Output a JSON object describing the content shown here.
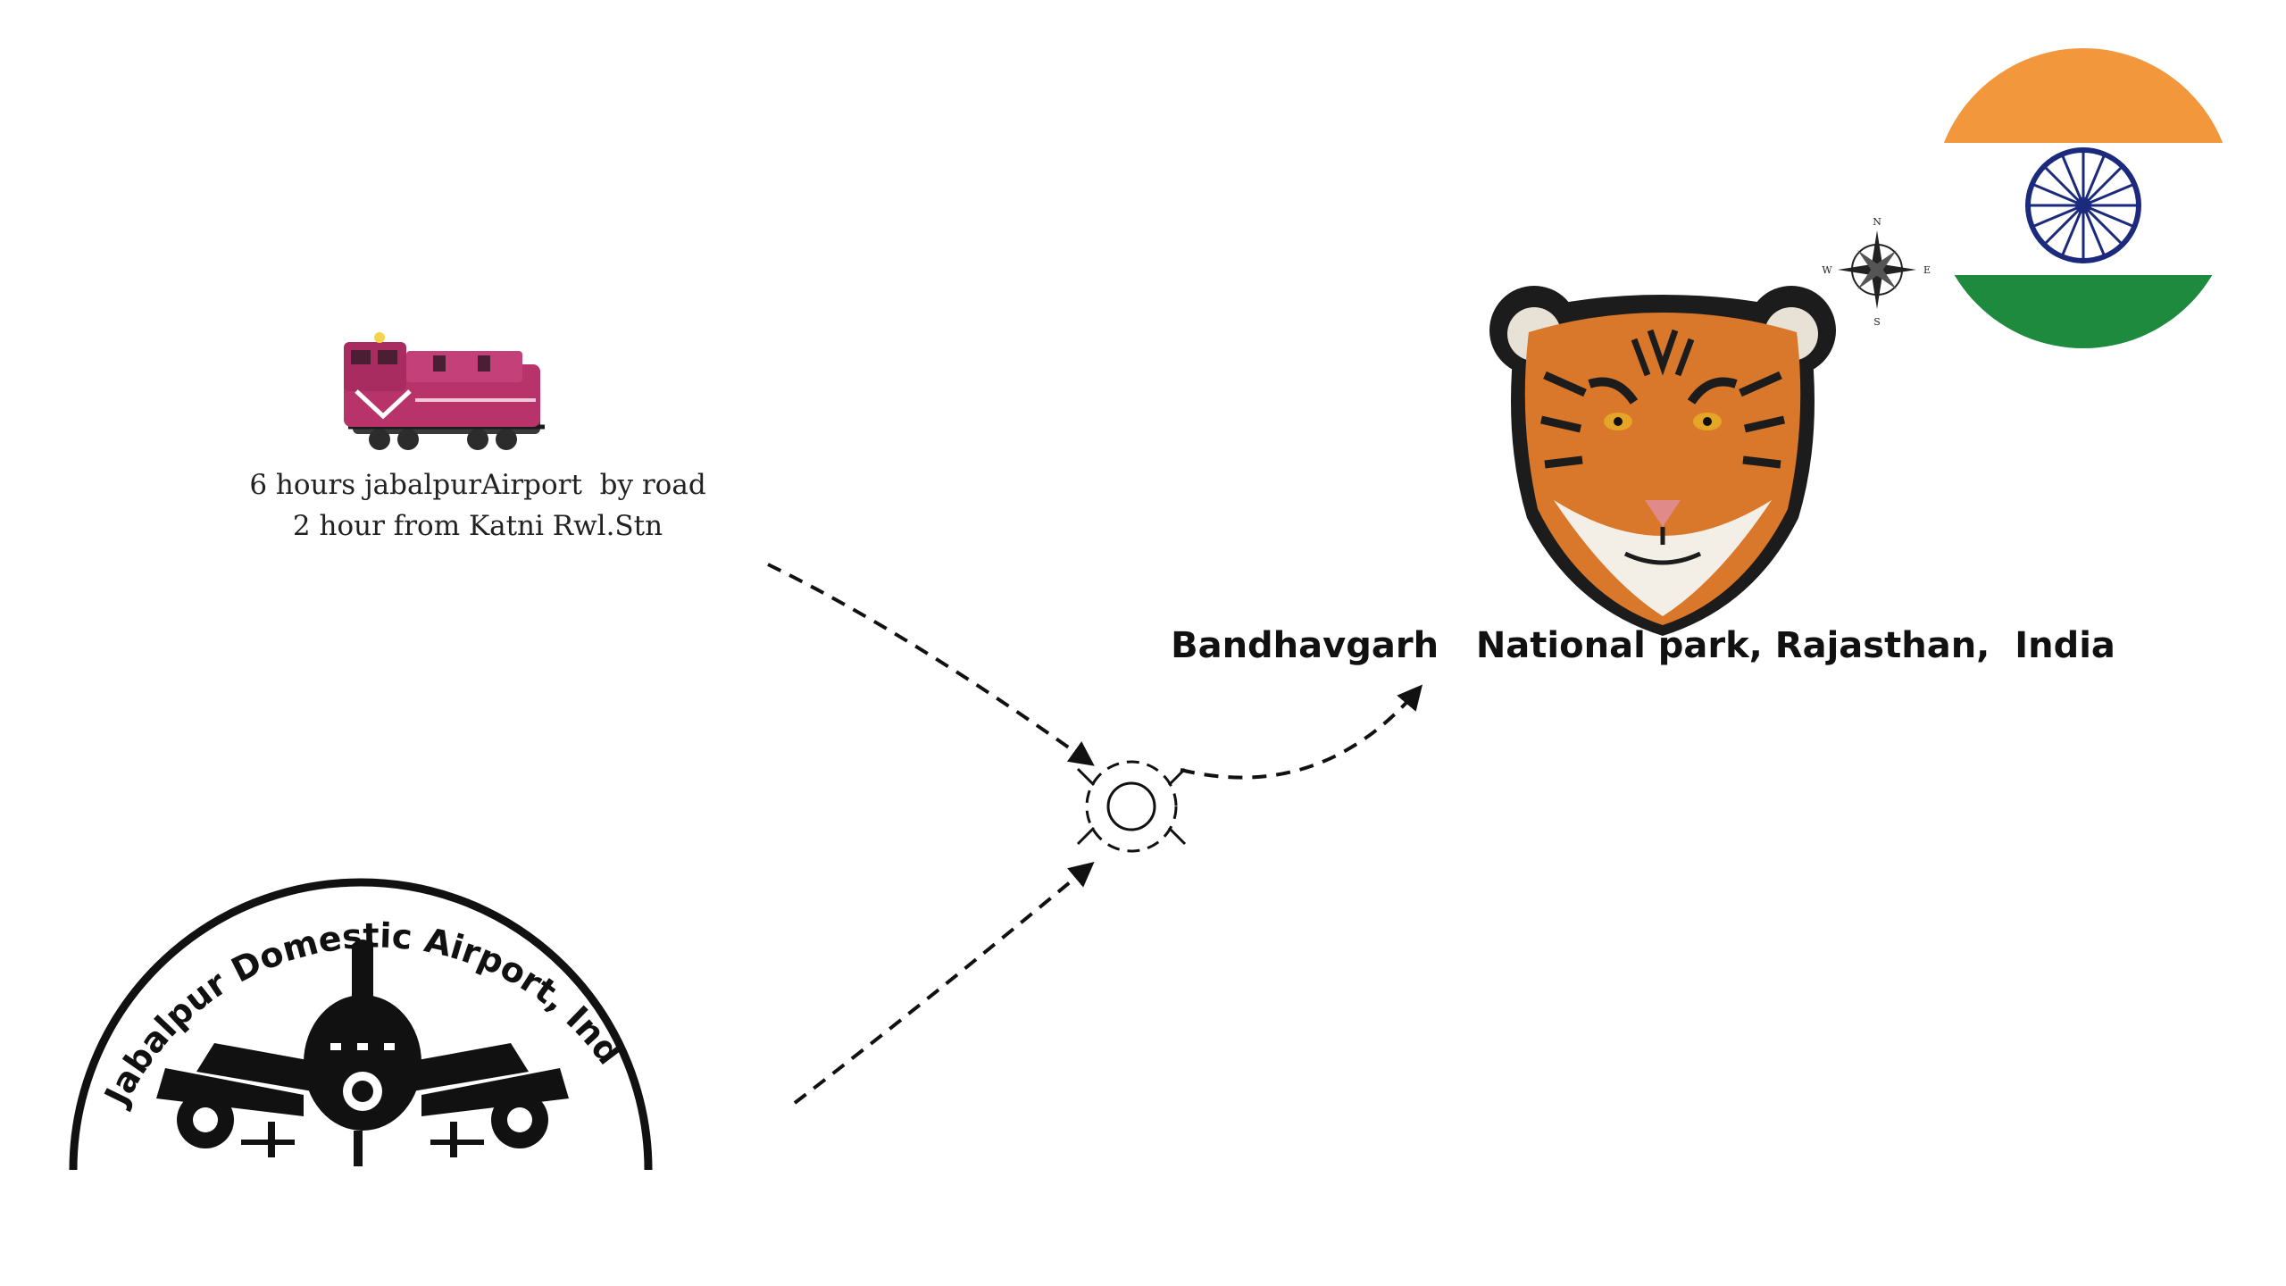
{
  "rail": {
    "line1": "6 hours jabalpurAirport  by road",
    "line2": "2 hour from Katni Rwl.Stn"
  },
  "airport": {
    "badge_text": "Jabalpur Domestic   Airport, India"
  },
  "destination": {
    "label": "Bandhavgarh   National park, Rajasthan,  India"
  },
  "compass": {
    "n": "N",
    "e": "E",
    "s": "S",
    "w": "W"
  },
  "icons": {
    "train": "train-engine-icon",
    "airplane": "airplane-icon",
    "junction": "roundabout-icon",
    "tiger": "tiger-head-icon",
    "compass": "compass-rose-icon",
    "flag": "india-flag-icon"
  },
  "colors": {
    "saffron": "#f2973b",
    "green": "#1e8a3e",
    "chakra": "#1b2a7d",
    "train_body": "#b9336b",
    "tiger_orange": "#d9772a"
  }
}
